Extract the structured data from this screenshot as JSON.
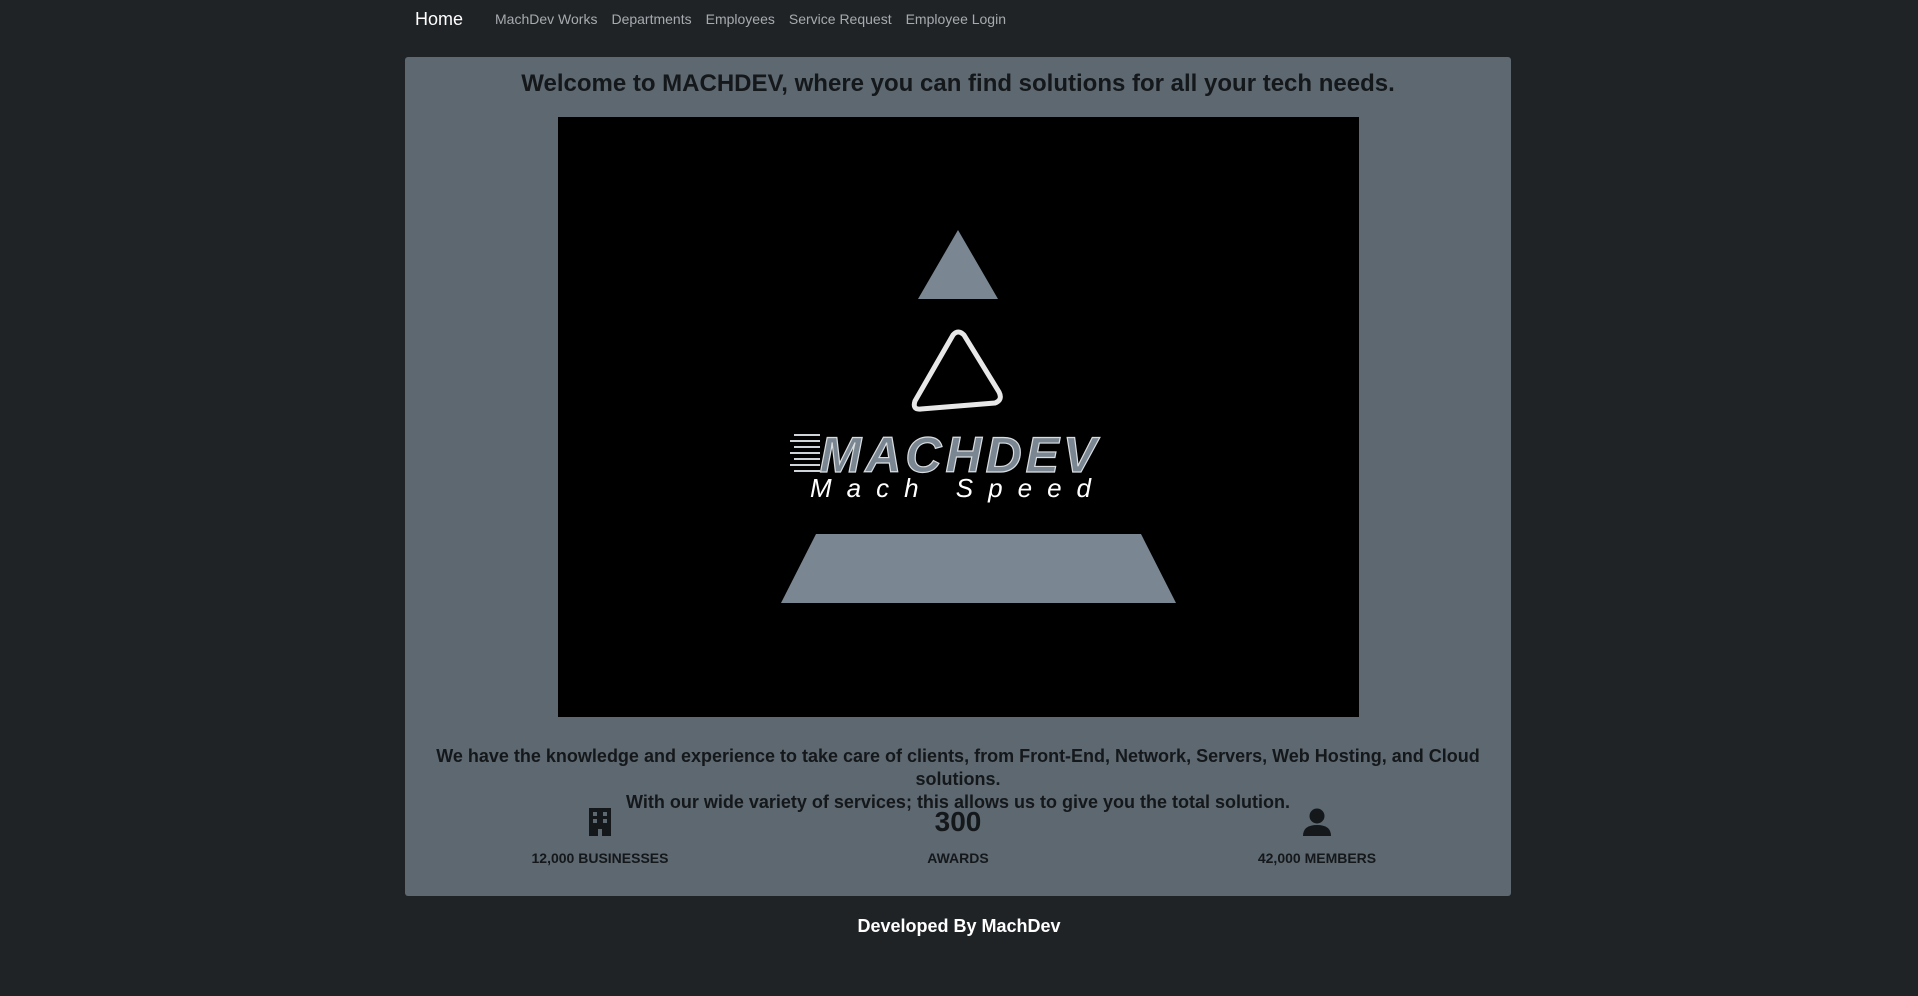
{
  "nav": {
    "brand": "Home",
    "links": [
      "MachDev Works",
      "Departments",
      "Employees",
      "Service Request",
      "Employee Login"
    ]
  },
  "main": {
    "welcome": "Welcome to MACHDEV, where you can find solutions for all your tech needs.",
    "logo": {
      "title": "MACHDEV",
      "tagline": "Mach Speed",
      "accent_color": "#7a8793"
    },
    "description": [
      "We have the knowledge and experience to take care of clients, from Front-End, Network, Servers, Web Hosting, and Cloud solutions.",
      "With our wide variety of services; this allows us to give you the total solution."
    ],
    "stats": [
      {
        "icon": "building-icon",
        "value": "",
        "label": "12,000 BUSINESSES"
      },
      {
        "icon": "",
        "value": "300",
        "label": "AWARDS"
      },
      {
        "icon": "user-icon",
        "value": "",
        "label": "42,000 MEMBERS"
      }
    ]
  },
  "footer": {
    "text": "Developed By MachDev"
  }
}
